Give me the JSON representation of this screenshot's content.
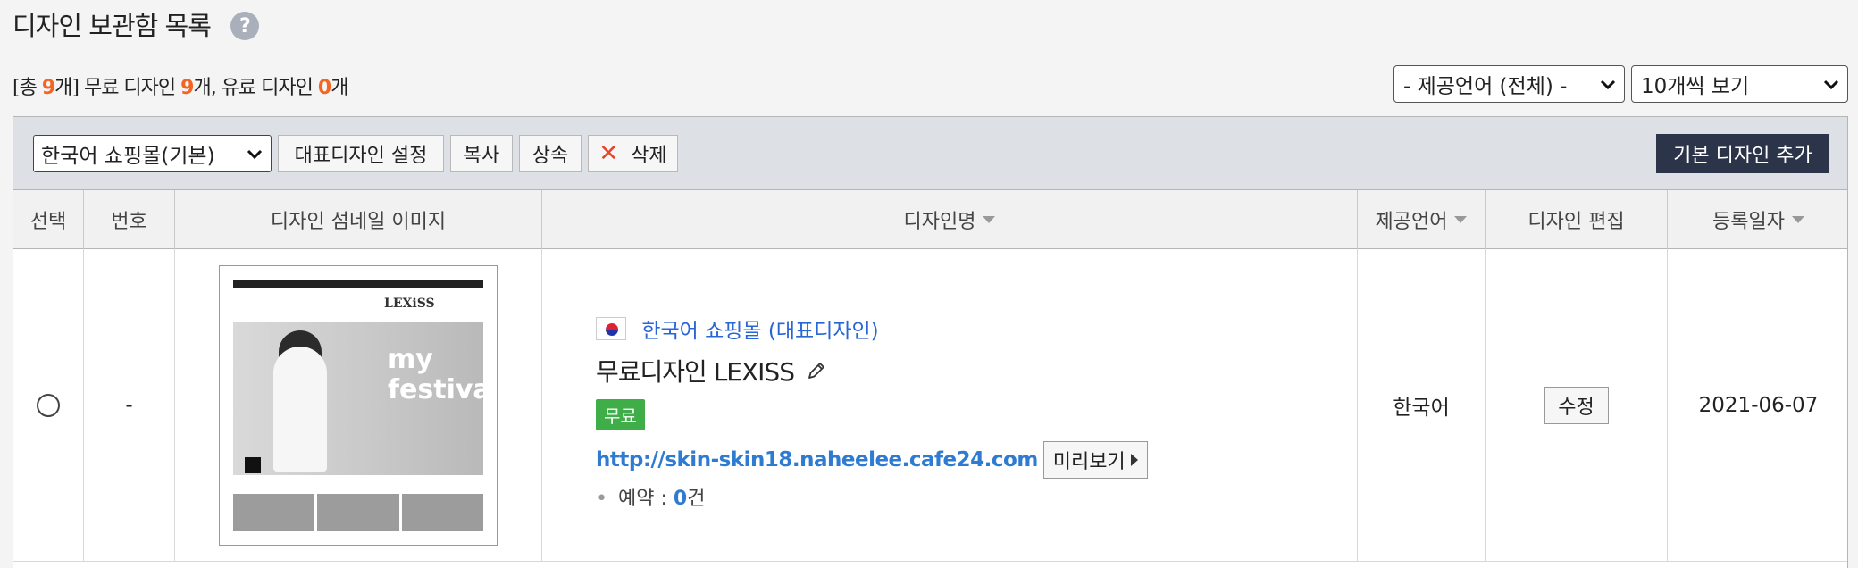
{
  "header": {
    "title": "디자인 보관함 목록",
    "help": "?"
  },
  "summary": {
    "p1": "[총 ",
    "total": "9",
    "p2": "개] 무료 디자인 ",
    "free": "9",
    "p3": "개, 유료 디자인 ",
    "paid": "0",
    "p4": "개"
  },
  "filters": {
    "language": "- 제공언어 (전체) -",
    "per_page": "10개씩 보기"
  },
  "toolbar": {
    "mall_select": "한국어 쇼핑몰(기본)",
    "set_representative": "대표디자인 설정",
    "copy": "복사",
    "inherit": "상속",
    "delete_icon": "✕",
    "delete": "삭제",
    "add_basic": "기본 디자인 추가"
  },
  "columns": {
    "select": "선택",
    "number": "번호",
    "thumbnail": "디자인 섬네일 이미지",
    "name": "디자인명",
    "language": "제공언어",
    "edit": "디자인 편집",
    "date": "등록일자"
  },
  "rows": [
    {
      "number": "-",
      "thumb_logo": "LEXiSS",
      "thumb_text1": "my",
      "thumb_text2": "festival",
      "mall_link": "한국어 쇼핑몰 (대표디자인)",
      "design_name": "무료디자인 LEXISS",
      "badge": "무료",
      "url": "http://skin-skin18.naheelee.cafe24.com",
      "preview": "미리보기",
      "reserve_label": "예약 : ",
      "reserve_count": "0",
      "reserve_unit": "건",
      "language": "한국어",
      "edit": "수정",
      "date": "2021-06-07"
    }
  ]
}
